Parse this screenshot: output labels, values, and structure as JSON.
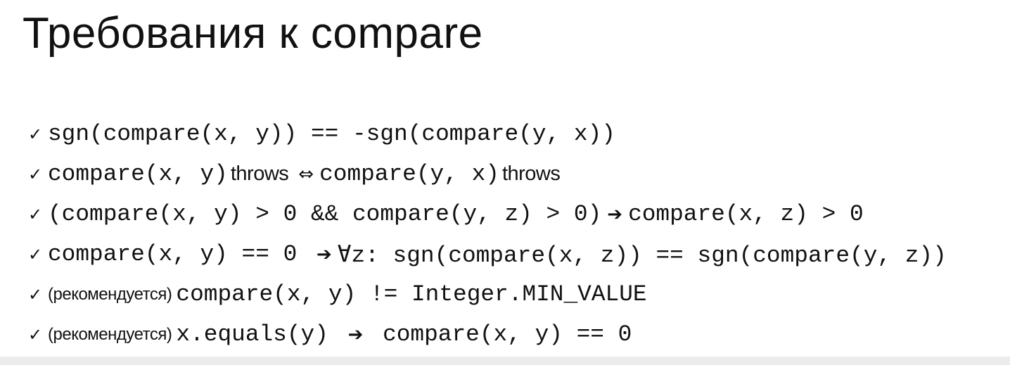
{
  "title": "Требования к compare",
  "check_icon": "✓",
  "items": [
    {
      "segments": [
        {
          "t": "sgn(compare(x, y)) == -sgn(compare(y, x))",
          "k": "mono"
        }
      ]
    },
    {
      "segments": [
        {
          "t": "compare(x, y)",
          "k": "mono"
        },
        {
          "t": "throws",
          "k": "sans"
        },
        {
          "t": "⇔",
          "k": "sym"
        },
        {
          "t": "compare(y, x)",
          "k": "mono"
        },
        {
          "t": "throws",
          "k": "sans"
        }
      ]
    },
    {
      "segments": [
        {
          "t": "(compare(x, y) > 0 && compare(y, z) > 0)",
          "k": "mono"
        },
        {
          "t": "➔",
          "k": "sym"
        },
        {
          "t": "compare(x, z) > 0",
          "k": "mono"
        }
      ]
    },
    {
      "segments": [
        {
          "t": "compare(x, y) == 0 ",
          "k": "mono"
        },
        {
          "t": "➔",
          "k": "sym"
        },
        {
          "t": "∀z: sgn(compare(x, z)) == sgn(compare(y, z))",
          "k": "mono"
        }
      ]
    },
    {
      "segments": [
        {
          "t": "(рекомендуется)",
          "k": "small"
        },
        {
          "t": "compare(x, y) != Integer.MIN_VALUE",
          "k": "mono"
        }
      ]
    },
    {
      "segments": [
        {
          "t": "(рекомендуется)",
          "k": "small"
        },
        {
          "t": "x.equals(y) ",
          "k": "mono"
        },
        {
          "t": "➔",
          "k": "sym"
        },
        {
          "t": " compare(x, y) == 0",
          "k": "mono"
        }
      ]
    }
  ]
}
